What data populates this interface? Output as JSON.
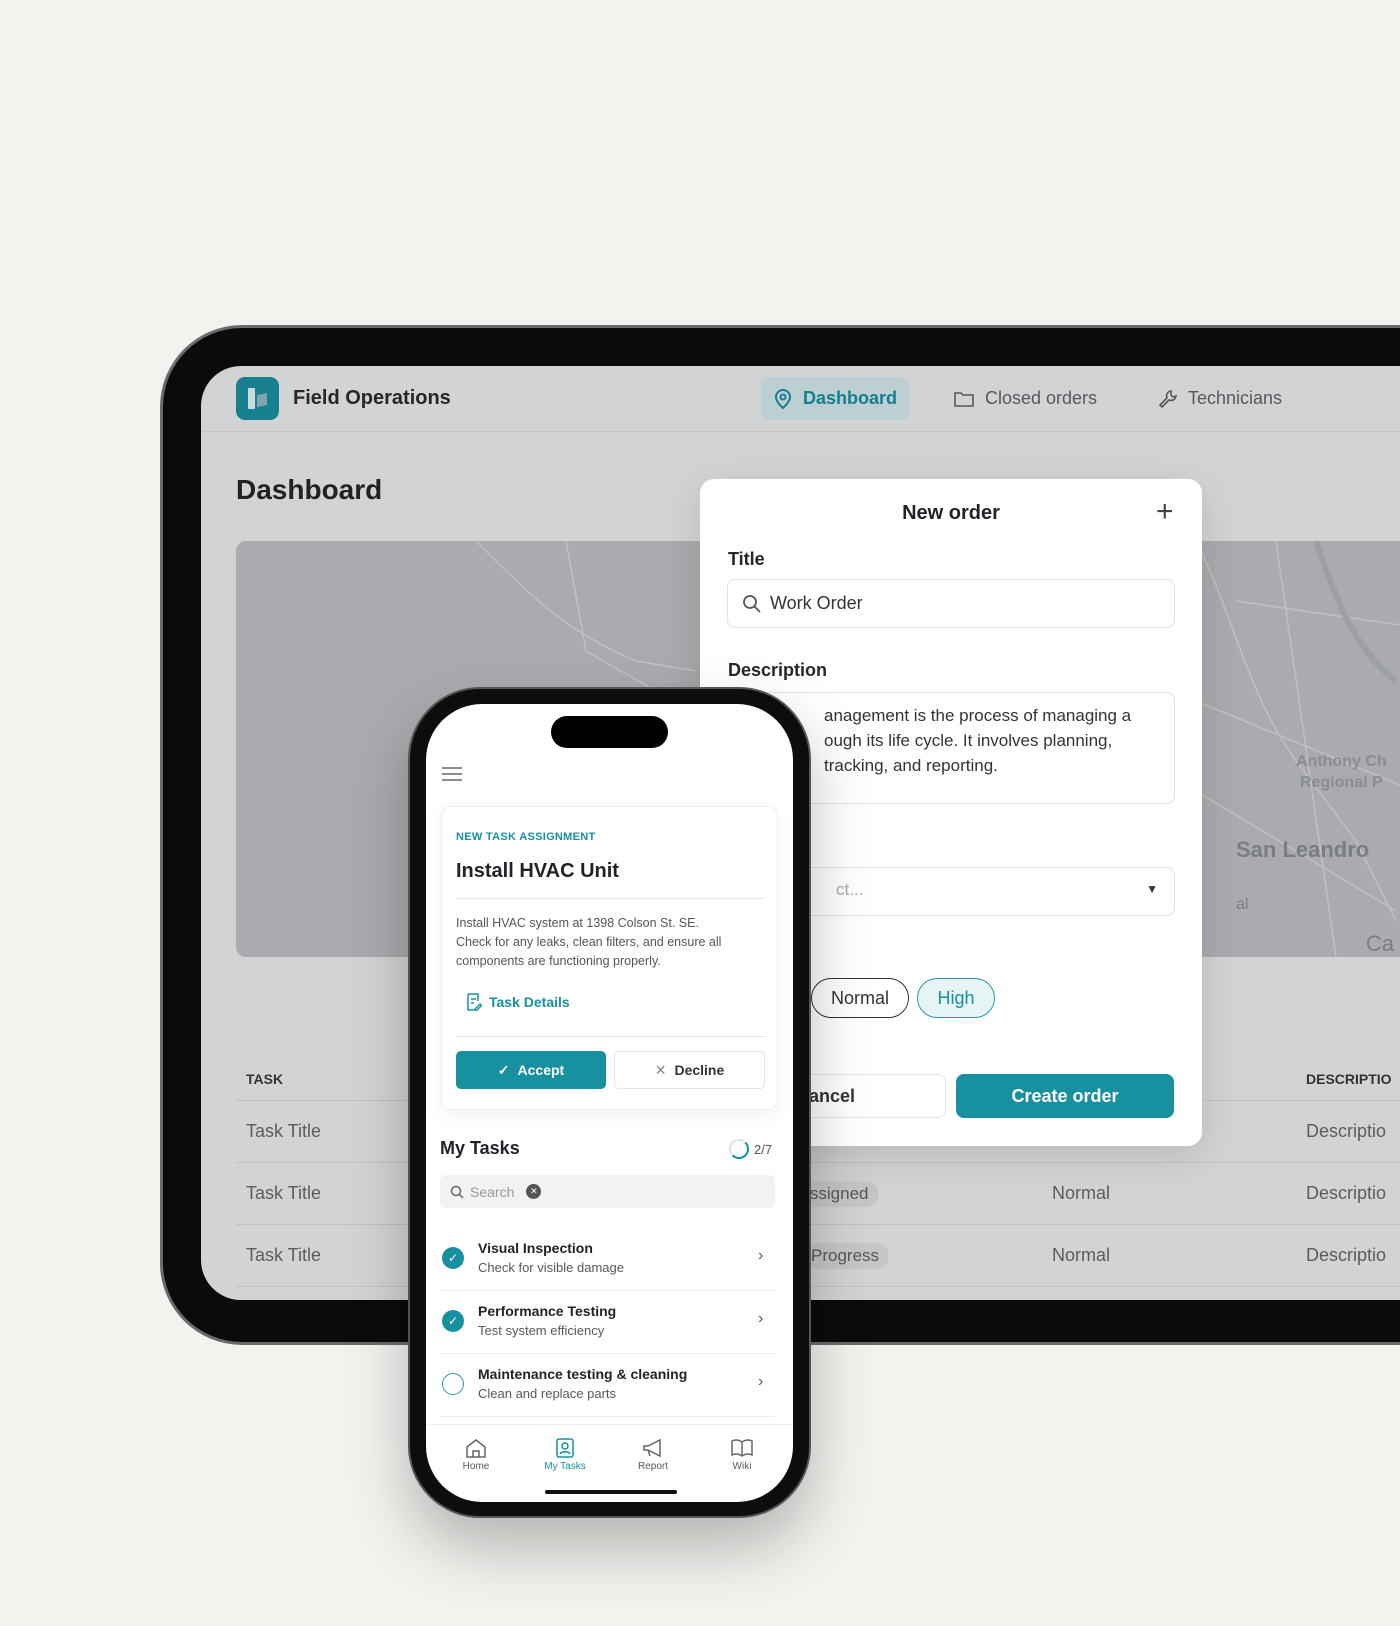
{
  "tablet": {
    "app_title": "Field Operations",
    "nav": [
      {
        "label": "Dashboard",
        "icon": "map-pin-icon",
        "active": true
      },
      {
        "label": "Closed orders",
        "icon": "folder-icon"
      },
      {
        "label": "Technicians",
        "icon": "wrench-icon"
      }
    ],
    "page_title": "Dashboard",
    "map_labels": [
      "Anthony Ch",
      "Regional P",
      "San Leandro",
      "al",
      "Ca"
    ],
    "table": {
      "headers": {
        "task": "TASK",
        "description": "DESCRIPTIO"
      },
      "rows": [
        {
          "task": "Task Title",
          "status": "",
          "priority": "",
          "description": "Descriptio"
        },
        {
          "task": "Task Title",
          "status": "nassigned",
          "priority": "Normal",
          "description": "Descriptio"
        },
        {
          "task": "Task Title",
          "status": "Progress",
          "priority": "Normal",
          "description": "Descriptio"
        }
      ]
    }
  },
  "modal": {
    "title": "New order",
    "title_label": "Title",
    "title_value": "Work Order",
    "description_label": "Description",
    "description_lines": [
      "anagement is the process of managing a",
      "ough its life cycle. It involves planning,",
      "tracking, and reporting."
    ],
    "select_placeholder": "ct...",
    "priorities": [
      {
        "label": "Normal",
        "selected": false
      },
      {
        "label": "High",
        "selected": true
      }
    ],
    "cancel": "Cancel",
    "create": "Create order"
  },
  "phone": {
    "card": {
      "eyebrow": "NEW TASK ASSIGNMENT",
      "title": "Install HVAC Unit",
      "desc_lines": [
        "Install HVAC system at 1398 Colson St. SE.",
        "Check for any leaks, clean filters, and ensure all",
        "components are functioning properly."
      ],
      "details_link": "Task Details",
      "accept": "Accept",
      "decline": "Decline"
    },
    "tasks_title": "My Tasks",
    "progress": "2/7",
    "search_placeholder": "Search",
    "tasks": [
      {
        "title": "Visual Inspection",
        "subtitle": "Check for visible damage",
        "done": true
      },
      {
        "title": "Performance Testing",
        "subtitle": "Test system efficiency",
        "done": true
      },
      {
        "title": "Maintenance testing & cleaning",
        "subtitle": "Clean and replace parts",
        "done": false
      }
    ],
    "tabs": [
      {
        "label": "Home",
        "icon": "home-icon"
      },
      {
        "label": "My Tasks",
        "icon": "tasks-icon",
        "active": true
      },
      {
        "label": "Report",
        "icon": "megaphone-icon"
      },
      {
        "label": "Wiki",
        "icon": "book-icon"
      }
    ]
  },
  "colors": {
    "accent": "#17909f",
    "background": "#f3f2ef"
  }
}
